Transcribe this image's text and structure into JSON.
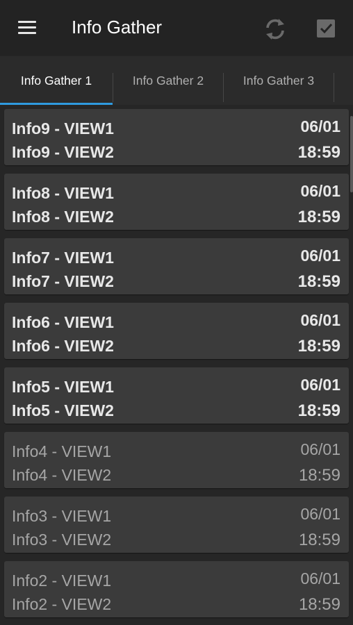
{
  "app": {
    "title": "Info Gather"
  },
  "toolbar": {
    "menu_icon": "hamburger-menu-icon",
    "refresh_icon": "refresh-icon",
    "check_icon": "checkbox-icon"
  },
  "tabs": [
    {
      "label": "Info Gather 1",
      "active": true
    },
    {
      "label": "Info Gather 2",
      "active": false
    },
    {
      "label": "Info Gather 3",
      "active": false
    }
  ],
  "colors": {
    "accent": "#2f9be0",
    "background": "#262626",
    "card": "#3b3b3b"
  },
  "items": [
    {
      "line1": "Info9 - VIEW1",
      "line2": "Info9 - VIEW2",
      "date": "06/01",
      "time": "18:59",
      "unread": true
    },
    {
      "line1": "Info8 - VIEW1",
      "line2": "Info8 - VIEW2",
      "date": "06/01",
      "time": "18:59",
      "unread": true
    },
    {
      "line1": "Info7 - VIEW1",
      "line2": "Info7 - VIEW2",
      "date": "06/01",
      "time": "18:59",
      "unread": true
    },
    {
      "line1": "Info6 - VIEW1",
      "line2": "Info6 - VIEW2",
      "date": "06/01",
      "time": "18:59",
      "unread": true
    },
    {
      "line1": "Info5 - VIEW1",
      "line2": "Info5 - VIEW2",
      "date": "06/01",
      "time": "18:59",
      "unread": true
    },
    {
      "line1": "Info4 - VIEW1",
      "line2": "Info4 - VIEW2",
      "date": "06/01",
      "time": "18:59",
      "unread": false
    },
    {
      "line1": "Info3 - VIEW1",
      "line2": "Info3 - VIEW2",
      "date": "06/01",
      "time": "18:59",
      "unread": false
    },
    {
      "line1": "Info2 - VIEW1",
      "line2": "Info2 - VIEW2",
      "date": "06/01",
      "time": "18:59",
      "unread": false
    }
  ]
}
